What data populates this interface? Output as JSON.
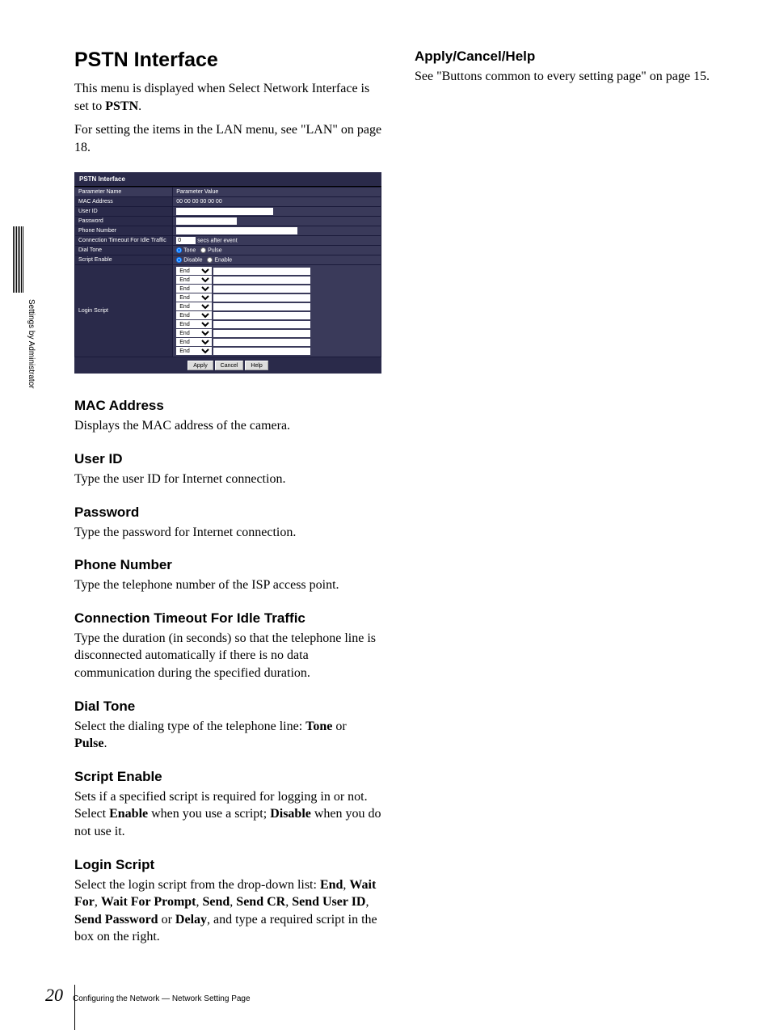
{
  "sidebar_label": "Settings by Administrator",
  "main_title": "PSTN Interface",
  "intro_1a": "This menu is displayed when Select Network Interface is set to ",
  "intro_1b": "PSTN",
  "intro_1c": ".",
  "intro_2": "For setting the items in the LAN menu, see \"LAN\" on page 18.",
  "screenshot": {
    "title": "PSTN Interface",
    "header_name": "Parameter Name",
    "header_value": "Parameter Value",
    "rows": {
      "mac_label": "MAC Address",
      "mac_value": "00 00 00 00 00 00",
      "user_id_label": "User ID",
      "password_label": "Password",
      "phone_label": "Phone Number",
      "timeout_label": "Connection Timeout For Idle Traffic",
      "timeout_value": "0",
      "timeout_suffix": "secs after event",
      "dialtone_label": "Dial Tone",
      "dialtone_opt1": "Tone",
      "dialtone_opt2": "Pulse",
      "script_enable_label": "Script Enable",
      "script_enable_opt1": "Disable",
      "script_enable_opt2": "Enable",
      "login_script_label": "Login Script",
      "login_script_option": "End"
    },
    "buttons": {
      "apply": "Apply",
      "cancel": "Cancel",
      "help": "Help"
    }
  },
  "sections": {
    "mac_h": "MAC Address",
    "mac_t": "Displays the MAC address of the camera.",
    "userid_h": "User ID",
    "userid_t": "Type the user ID for Internet connection.",
    "password_h": "Password",
    "password_t": "Type the password for Internet connection.",
    "phone_h": "Phone Number",
    "phone_t": "Type the telephone number of the ISP access point.",
    "timeout_h": "Connection Timeout For Idle Traffic",
    "timeout_t": "Type the duration (in seconds) so that the telephone line is disconnected automatically if there is no data communication during the specified duration.",
    "dialtone_h": "Dial Tone",
    "dialtone_t1": "Select the dialing type of the telephone line: ",
    "dialtone_b1": "Tone",
    "dialtone_t2": " or ",
    "dialtone_b2": "Pulse",
    "dialtone_t3": ".",
    "scripten_h": "Script Enable",
    "scripten_t1": "Sets if a specified script is required for logging in or not. Select ",
    "scripten_b1": "Enable",
    "scripten_t2": " when you use a script; ",
    "scripten_b2": "Disable",
    "scripten_t3": " when you do not use it.",
    "login_h": "Login Script",
    "login_t1": "Select the login script from the drop-down list: ",
    "login_b1": "End",
    "login_c1": ", ",
    "login_b2": "Wait For",
    "login_c2": ", ",
    "login_b3": "Wait For Prompt",
    "login_c3": ", ",
    "login_b4": "Send",
    "login_c4": ", ",
    "login_b5": "Send CR",
    "login_c5": ", ",
    "login_b6": "Send User ID",
    "login_c6": ", ",
    "login_b7": "Send Password",
    "login_c7": " or ",
    "login_b8": "Delay",
    "login_t2": ", and type a required script in the box on the right."
  },
  "right_col": {
    "h": "Apply/Cancel/Help",
    "t": "See \"Buttons common to every setting page\" on page 15."
  },
  "footer": {
    "page": "20",
    "text": "Configuring the Network — Network Setting Page"
  }
}
